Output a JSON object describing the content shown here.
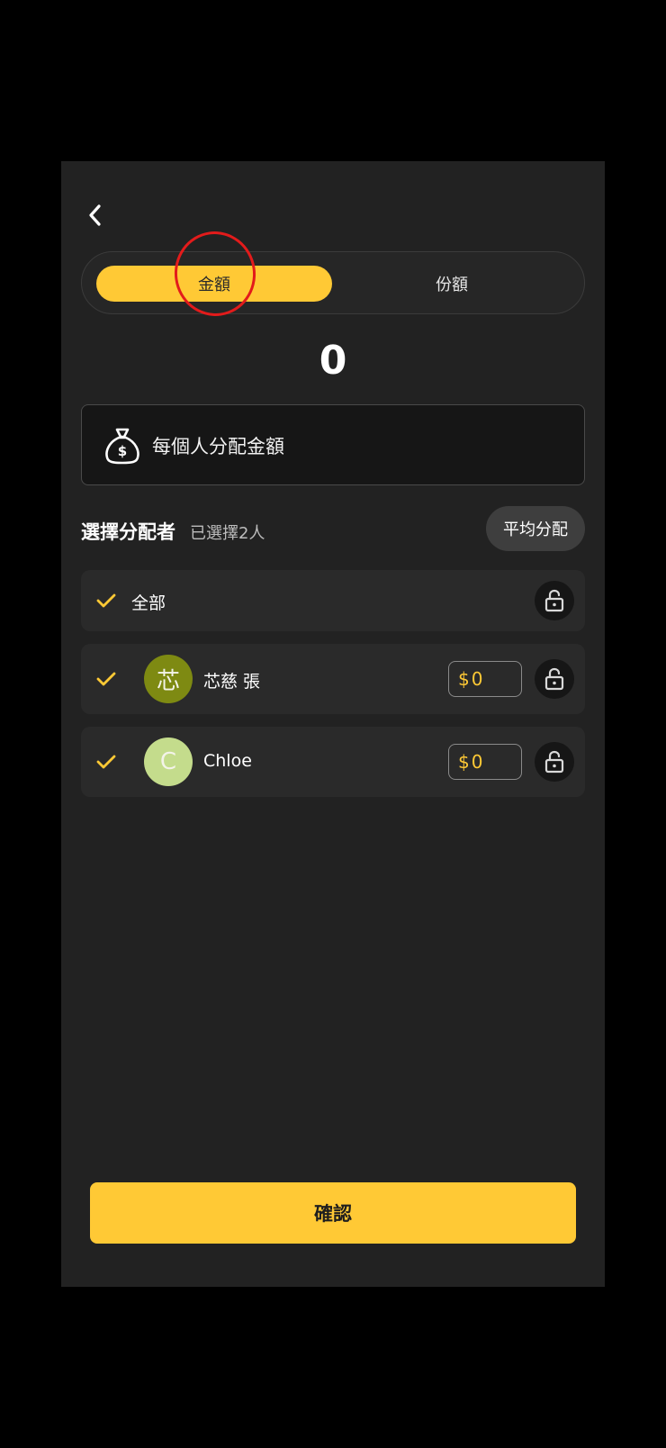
{
  "header": {
    "back_icon": "chevron-left-icon"
  },
  "mode_tabs": {
    "amount_label": "金額",
    "share_label": "份額",
    "selected": "amount"
  },
  "total_amount": "0",
  "info_box": {
    "icon": "money-bag-icon",
    "text": "每個人分配金額"
  },
  "section": {
    "title": "選擇分配者",
    "selected_count_text": "已選擇2人",
    "average_button": "平均分配"
  },
  "all_row": {
    "label": "全部",
    "checked": true
  },
  "members": [
    {
      "initial": "芯",
      "name": "芯慈 張",
      "currency": "$",
      "amount": "0",
      "checked": true,
      "avatar_color": "#7E8A12"
    },
    {
      "initial": "C",
      "name": "Chloe",
      "currency": "$",
      "amount": "0",
      "checked": true,
      "avatar_color": "#C4DC8C"
    }
  ],
  "confirm_button": "確認",
  "colors": {
    "accent": "#FFC935",
    "background": "#222222",
    "annotation": "#E31B1B"
  }
}
